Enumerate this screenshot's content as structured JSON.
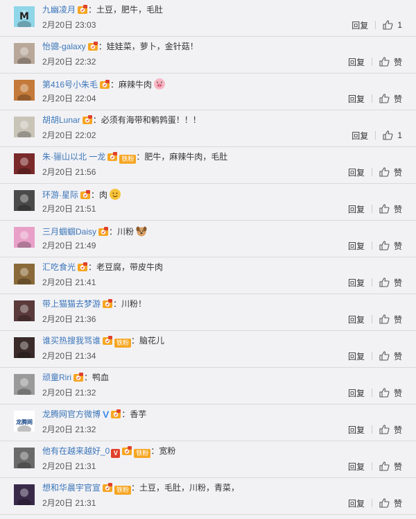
{
  "actions": {
    "reply_label": "回复",
    "like_label": "赞"
  },
  "comments": [
    {
      "user": "九幽凌月",
      "content": "：土豆，肥牛，毛肚",
      "time": "2月20日 23:03",
      "likes": "1",
      "fan": false,
      "avatar_color": "#8fd6e8",
      "avatar_text": "M"
    },
    {
      "user": "怡骢-galaxy",
      "content": "：娃娃菜，萝卜，金针菇！",
      "time": "2月20日 22:32",
      "likes": "赞",
      "fan": false,
      "avatar_color": "#b9a89a",
      "avatar_text": ""
    },
    {
      "user": "第416号小朱毛",
      "content": "：麻辣牛肉",
      "time": "2月20日 22:04",
      "likes": "赞",
      "fan": false,
      "avatar_color": "#c47a3a",
      "avatar_text": "",
      "emoji": "pig-emoji"
    },
    {
      "user": "胡胡Lunar",
      "content": "：必须有海带和鹌鹑蛋！！！",
      "time": "2月20日 22:02",
      "likes": "1",
      "fan": false,
      "avatar_color": "#c9c4b8",
      "avatar_text": ""
    },
    {
      "user": "朱·骊山以北 一龙",
      "content": "：肥牛，麻辣牛肉，毛肚",
      "time": "2月20日 21:56",
      "likes": "赞",
      "fan": true,
      "avatar_color": "#7a2a2a",
      "avatar_text": ""
    },
    {
      "user": "环游·星际",
      "content": "：肉",
      "time": "2月20日 21:51",
      "likes": "赞",
      "fan": false,
      "avatar_color": "#4a4a4a",
      "avatar_text": "",
      "emoji": "smile-emoji"
    },
    {
      "user": "三月蝈蝈Daisy",
      "content": "：川粉",
      "time": "2月20日 21:49",
      "likes": "赞",
      "fan": false,
      "avatar_color": "#e8a0c8",
      "avatar_text": "",
      "emoji": "dog-emoji"
    },
    {
      "user": "汇吃食光",
      "content": "：老豆腐，带皮牛肉",
      "time": "2月20日 21:41",
      "likes": "赞",
      "fan": false,
      "avatar_color": "#8a6a3a",
      "avatar_text": ""
    },
    {
      "user": "带上猫猫去梦游",
      "content": "：川粉！",
      "time": "2月20日 21:36",
      "likes": "赞",
      "fan": false,
      "avatar_color": "#5a3a3a",
      "avatar_text": ""
    },
    {
      "user": "谁买热搜我骂谁",
      "content": "：脑花儿",
      "time": "2月20日 21:34",
      "likes": "赞",
      "fan": true,
      "avatar_color": "#3a2a2a",
      "avatar_text": ""
    },
    {
      "user": "顽童Riri",
      "content": "：鸭血",
      "time": "2月20日 21:32",
      "likes": "赞",
      "fan": false,
      "avatar_color": "#9a9a9a",
      "avatar_text": ""
    },
    {
      "user": "龙腾网官方微博",
      "content": "：香芋",
      "time": "2月20日 21:32",
      "likes": "赞",
      "fan": false,
      "verified": true,
      "avatar_color": "#ffffff",
      "avatar_text": "龙腾网"
    },
    {
      "user": "他有在越来越好_0",
      "content": "：宽粉",
      "time": "2月20日 21:31",
      "likes": "赞",
      "fan": true,
      "vred": true,
      "avatar_color": "#6a6a6a",
      "avatar_text": ""
    },
    {
      "user": "想和华晨宇官宣",
      "content": "：土豆，毛肚，川粉，青菜，",
      "time": "2月20日 21:31",
      "likes": "赞",
      "fan": true,
      "avatar_color": "#3a2a4a",
      "avatar_text": ""
    }
  ],
  "fan_badge_label": "铁粉",
  "verified_label": "V",
  "vred_label": "V"
}
